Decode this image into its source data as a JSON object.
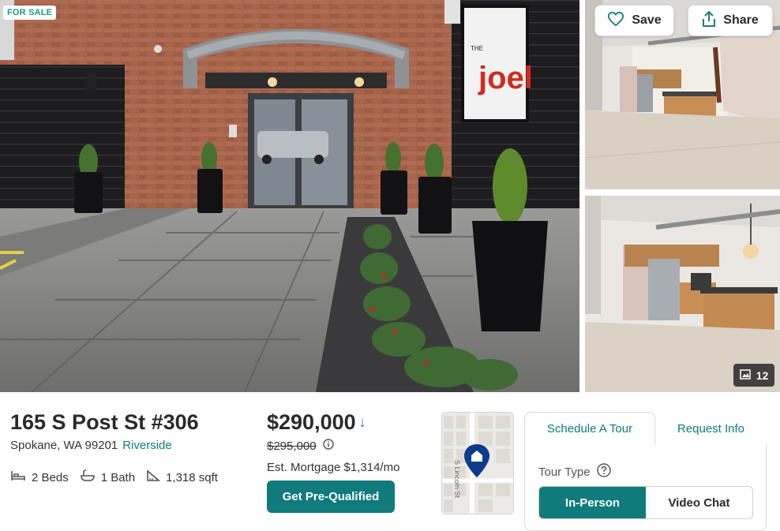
{
  "listing": {
    "status_badge": "FOR SALE",
    "address_line": "165 S Post St #306",
    "city_state_zip": "Spokane, WA 99201",
    "neighborhood": "Riverside",
    "beds": "2 Beds",
    "baths": "1 Bath",
    "sqft": "1,318 sqft"
  },
  "pricing": {
    "price": "$290,000",
    "trend_arrow": "↓",
    "previous_price": "$295,000",
    "mortgage": "Est. Mortgage $1,314/mo",
    "prequal_label": "Get Pre-Qualified"
  },
  "gallery": {
    "save_label": "Save",
    "share_label": "Share",
    "photo_count": "12",
    "sign_small": "THE",
    "sign_text": "joel"
  },
  "map": {
    "street_label": "S Lincoln St"
  },
  "tour": {
    "tabs": [
      {
        "label": "Schedule A Tour",
        "active": true
      },
      {
        "label": "Request Info",
        "active": false
      }
    ],
    "tour_type_label": "Tour Type",
    "options": [
      {
        "label": "In-Person",
        "selected": true
      },
      {
        "label": "Video Chat",
        "selected": false
      }
    ]
  },
  "colors": {
    "accent": "#0f7b7b",
    "badge_text": "#1a9a7a",
    "map_pin": "#0b3b8c"
  },
  "icons": {
    "save": "heart-icon",
    "share": "share-icon",
    "photos": "image-icon",
    "beds": "bed-icon",
    "baths": "bathtub-icon",
    "sqft": "ruler-icon",
    "info": "info-icon",
    "help": "help-icon",
    "map_pin": "map-pin-icon"
  }
}
